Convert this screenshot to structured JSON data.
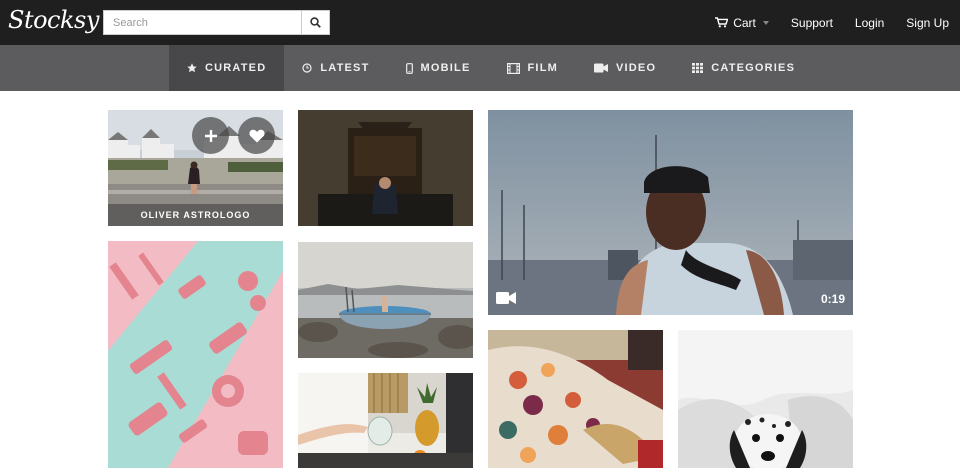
{
  "brand": {
    "logo_text": "Stocksy"
  },
  "search": {
    "placeholder": "Search",
    "value": ""
  },
  "toplinks": {
    "cart": "Cart",
    "support": "Support",
    "login": "Login",
    "signup": "Sign Up"
  },
  "nav": [
    {
      "label": "CURATED",
      "icon": "star-icon",
      "active": true
    },
    {
      "label": "LATEST",
      "icon": "clock-icon",
      "active": false
    },
    {
      "label": "MOBILE",
      "icon": "mobile-icon",
      "active": false
    },
    {
      "label": "FILM",
      "icon": "film-icon",
      "active": false
    },
    {
      "label": "VIDEO",
      "icon": "video-camera-icon",
      "active": false
    },
    {
      "label": "CATEGORIES",
      "icon": "grid-icon",
      "active": false
    }
  ],
  "tiles": {
    "first": {
      "photographer": "OLIVER ASTROLOGO"
    },
    "video": {
      "duration": "0:19"
    }
  },
  "colors": {
    "topbar": "#1f1f1f",
    "nav": "#5c5b5d",
    "nav_active": "#48474a"
  }
}
